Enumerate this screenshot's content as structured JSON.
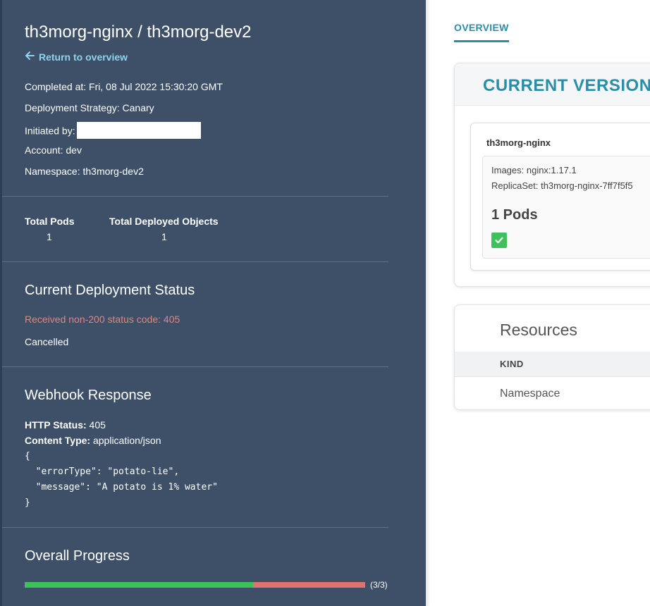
{
  "header": {
    "title": "th3morg-nginx / th3morg-dev2",
    "return_label": "Return to overview"
  },
  "details": {
    "completed": "Completed at: Fri, 08 Jul 2022 15:30:20 GMT",
    "strategy": "Deployment Strategy: Canary",
    "initiated_label": "Initiated by:",
    "account": "Account: dev",
    "namespace": "Namespace: th3morg-dev2"
  },
  "stats": {
    "total_pods_label": "Total Pods",
    "total_pods_value": "1",
    "total_objects_label": "Total Deployed Objects",
    "total_objects_value": "1"
  },
  "deployment_status": {
    "title": "Current Deployment Status",
    "error": "Received non-200 status code: 405",
    "state": "Cancelled"
  },
  "webhook": {
    "title": "Webhook Response",
    "http_status_label": "HTTP Status:",
    "http_status_value": "405",
    "content_type_label": "Content Type:",
    "content_type_value": "application/json",
    "body_lines": [
      "{",
      "  \"errorType\": \"potato-lie\",",
      "  \"message\": \"A potato is 1% water\"",
      "}"
    ]
  },
  "progress": {
    "title": "Overall Progress",
    "count_label": "(3/3)",
    "success_fraction": 0.67,
    "colors": {
      "success": "#3ec15b",
      "failure": "#e07272"
    }
  },
  "tabs": {
    "overview": "OVERVIEW"
  },
  "current_version": {
    "title": "CURRENT VERSION",
    "name": "th3morg-nginx",
    "images": "Images: nginx:1.17.1",
    "replicaset": "ReplicaSet: th3morg-nginx-7ff7f5f5",
    "pods": "1 Pods"
  },
  "resources": {
    "title": "Resources",
    "kind_header": "KIND",
    "rows": [
      "Namespace"
    ]
  },
  "colors": {
    "panel_bg": "#3d5068",
    "accent": "#2a8ea8",
    "link": "#8fd3ef",
    "error": "#e38383"
  }
}
